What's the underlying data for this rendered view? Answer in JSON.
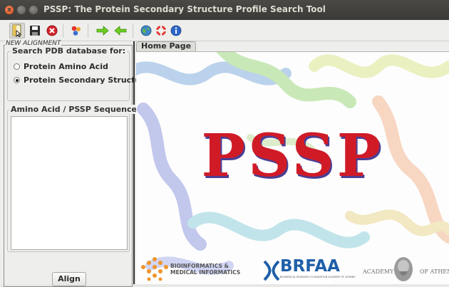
{
  "window": {
    "title": "PSSP: The Protein Secondary Structure Profile Search Tool",
    "close_glyph": "x"
  },
  "toolbar": {
    "buttons": [
      {
        "icon": "new-document-icon",
        "selected": true
      },
      {
        "icon": "save-icon"
      },
      {
        "icon": "stop-icon"
      },
      {
        "icon": "molecule-icon"
      },
      {
        "icon": "arrow-right-icon"
      },
      {
        "icon": "arrow-left-icon"
      },
      {
        "icon": "globe-icon"
      },
      {
        "icon": "help-lifebuoy-icon"
      },
      {
        "icon": "info-icon"
      }
    ]
  },
  "left_panel": {
    "frame_title": "NEW ALIGNMENT",
    "search_group_title": "Search PDB database for:",
    "options": [
      {
        "label": "Protein Amino Acid",
        "selected": false
      },
      {
        "label": "Protein Secondary Structure",
        "selected": true
      }
    ],
    "sequence_group_title": "Amino Acid / PSSP Sequence:",
    "sequence_value": "",
    "align_button": "Align"
  },
  "tabs": [
    {
      "label": "Home Page",
      "active": true
    }
  ],
  "home": {
    "title": "PSSP",
    "logos": {
      "bioinformatics": [
        "BIOINFORMATICS &",
        "MEDICAL INFORMATICS"
      ],
      "brfaa": "BRFAA",
      "brfaa_sub": "BIOMEDICAL RESEARCH FOUNDATION ACADEMY OF ATHENS",
      "academy_left": "ACADEMY",
      "academy_right": "OF ATHENS"
    }
  },
  "colors": {
    "title_red": "#d01b27",
    "title_shadow": "#4a3f95",
    "titlebar": "#3c3b37",
    "close_button": "#df4b16"
  }
}
